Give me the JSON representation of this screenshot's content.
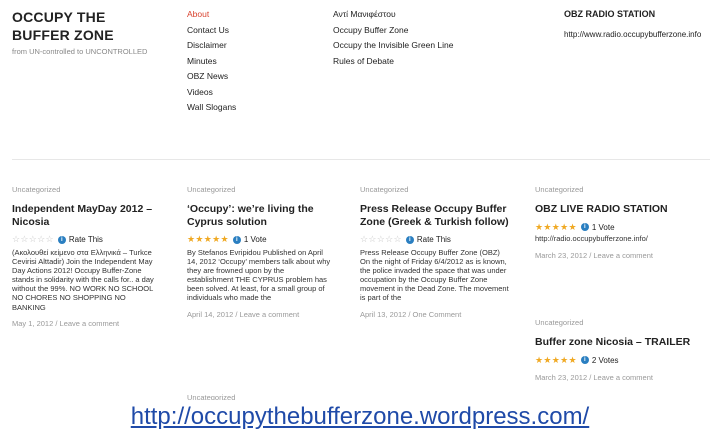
{
  "site": {
    "title": "OCCUPY THE BUFFER ZONE",
    "description": "from UN-controlled to UNCONTROLLED"
  },
  "menu": {
    "col_a": [
      "About",
      "Contact Us",
      "Disclaimer",
      "Minutes",
      "OBZ News",
      "Videos",
      "Wall Slogans"
    ],
    "col_b": [
      "Αντί Μανιφέστου",
      "Occupy Buffer Zone",
      "Occupy the Invisible Green Line",
      "Rules of Debate"
    ],
    "active": "About"
  },
  "widget": {
    "title": "OBZ RADIO STATION",
    "link": "http://www.radio.occupybufferzone.info"
  },
  "posts": [
    {
      "category": "Uncategorized",
      "title": "Independent MayDay 2012 – Nicosia",
      "rating": "Rate This",
      "stars": "empty",
      "excerpt": "(Ακολουθεί κείμενο στα Ελληνικά – Turkce Cevirisi Alttadir) Join the Independent May Day Actions 2012! Occupy Buffer-Zone stands in solidarity with the calls for.. a day without the 99%. NO WORK NO SCHOOL NO CHORES NO SHOPPING NO BANKING",
      "meta": "May 1, 2012 / Leave a comment"
    },
    {
      "category": "Uncategorized",
      "title": "‘Occupy’: we’re living the Cyprus solution",
      "rating": "1 Vote",
      "stars": "full",
      "excerpt": "By Stefanos Evripidou Published on April 14, 2012 ‘Occupy’ members talk about why they are frowned upon by the establishment THE CYPRUS problem has been solved. At least, for a small group of individuals who made the",
      "meta": "April 14, 2012 / Leave a comment"
    },
    {
      "category": "Uncategorized",
      "title": "Press Release Occupy Buffer Zone (Greek & Turkish follow)",
      "rating": "Rate This",
      "stars": "empty",
      "excerpt": "Press Release Occupy Buffer Zone (OBZ) On the night of Friday 6/4/2012 as is known, the police invaded the space that was under occupation by the Occupy Buffer Zone movement in the Dead Zone. The movement is part of the",
      "meta": "April 13, 2012 / One Comment"
    },
    {
      "category": "Uncategorized",
      "title": "OBZ LIVE RADIO STATION",
      "rating": "1 Vote",
      "stars": "full",
      "link": "http://radio.occupybufferzone.info/",
      "meta": "March 23, 2012 / Leave a comment"
    },
    {
      "category": "Uncategorized",
      "title": "Buffer zone Nicosia – TRAILER",
      "rating": "2 Votes",
      "stars": "full",
      "meta": "March 23, 2012 / Leave a comment"
    }
  ],
  "bottom_category": "Uncategorized",
  "url_banner": "http://occupythebufferzone.wordpress.com/",
  "colors": {
    "accent": "#d9432f",
    "star": "#f0a923",
    "link": "#1f4aa8"
  }
}
